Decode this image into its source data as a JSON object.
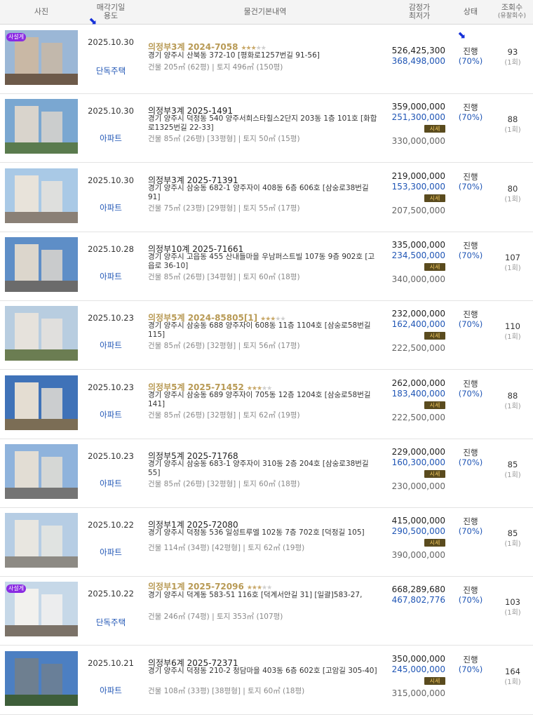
{
  "header": {
    "photo": "사진",
    "date_line1": "매각기일",
    "date_line2": "용도",
    "info": "물건기본내역",
    "price_line1": "감정가",
    "price_line2": "최저가",
    "status": "상태",
    "views_line1": "조회수",
    "views_line2": "(유찰회수)"
  },
  "rows": [
    {
      "badge": "사설게",
      "date": "2025.10.30",
      "use": "단독주택",
      "case": "의정부3계 2024-7058",
      "gold": true,
      "stars": 3,
      "addr": "경기 양주시 산북동 372-10 [평화로1257번길 91-56]",
      "area": "건물 205㎡ (62평)  |  토지 496㎡ (150평)",
      "appraisal": "526,425,300",
      "minimum": "368,498,000",
      "market": "",
      "status": "진행",
      "pct": "(70%)",
      "views": "93",
      "fails": "(1회)"
    },
    {
      "badge": "",
      "date": "2025.10.30",
      "use": "아파트",
      "case": "의정부3계 2025-1491",
      "gold": false,
      "stars": 0,
      "addr": "경기 양주시 덕정동 540 양주서희스타힐스2단지 203동 1층 101호 [화합로1325번길 22-33]",
      "area": "건물 85㎡ (26평) [33평형]  |  토지 50㎡ (15평)",
      "appraisal": "359,000,000",
      "minimum": "251,300,000",
      "market": "330,000,000",
      "status": "진행",
      "pct": "(70%)",
      "views": "88",
      "fails": "(1회)"
    },
    {
      "badge": "",
      "date": "2025.10.30",
      "use": "아파트",
      "case": "의정부3계 2025-71391",
      "gold": false,
      "stars": 0,
      "addr": "경기 양주시 삼숭동 682-1 양주자이 408동 6층 606호 [삼숭로38번길 91]",
      "area": "건물 75㎡ (23평) [29평형]  |  토지 55㎡ (17평)",
      "appraisal": "219,000,000",
      "minimum": "153,300,000",
      "market": "207,500,000",
      "status": "진행",
      "pct": "(70%)",
      "views": "80",
      "fails": "(1회)"
    },
    {
      "badge": "",
      "date": "2025.10.28",
      "use": "아파트",
      "case": "의정부10계 2025-71661",
      "gold": false,
      "stars": 0,
      "addr": "경기 양주시 고읍동 455 산내들마을 우남퍼스트빌 107동 9층 902호 [고읍로 36-10]",
      "area": "건물 85㎡ (26평) [34평형]  |  토지 60㎡ (18평)",
      "appraisal": "335,000,000",
      "minimum": "234,500,000",
      "market": "340,000,000",
      "status": "진행",
      "pct": "(70%)",
      "views": "107",
      "fails": "(1회)"
    },
    {
      "badge": "",
      "date": "2025.10.23",
      "use": "아파트",
      "case": "의정부5계 2024-85805[1]",
      "gold": true,
      "stars": 3,
      "addr": "경기 양주시 삼숭동 688 양주자이 608동 11층 1104호 [삼숭로58번길 115]",
      "area": "건물 85㎡ (26평) [32평형]  |  토지 56㎡ (17평)",
      "appraisal": "232,000,000",
      "minimum": "162,400,000",
      "market": "222,500,000",
      "status": "진행",
      "pct": "(70%)",
      "views": "110",
      "fails": "(1회)"
    },
    {
      "badge": "",
      "date": "2025.10.23",
      "use": "아파트",
      "case": "의정부5계 2025-71452",
      "gold": true,
      "stars": 3,
      "addr": "경기 양주시 삼숭동 689 양주자이 705동 12층 1204호 [삼숭로58번길 141]",
      "area": "건물 85㎡ (26평) [32평형]  |  토지 62㎡ (19평)",
      "appraisal": "262,000,000",
      "minimum": "183,400,000",
      "market": "222,500,000",
      "status": "진행",
      "pct": "(70%)",
      "views": "88",
      "fails": "(1회)"
    },
    {
      "badge": "",
      "date": "2025.10.23",
      "use": "아파트",
      "case": "의정부5계 2025-71768",
      "gold": false,
      "stars": 0,
      "addr": "경기 양주시 삼숭동 683-1 양주자이 310동 2층 204호 [삼숭로38번길 55]",
      "area": "건물 85㎡ (26평) [32평형]  |  토지 60㎡ (18평)",
      "appraisal": "229,000,000",
      "minimum": "160,300,000",
      "market": "230,000,000",
      "status": "진행",
      "pct": "(70%)",
      "views": "85",
      "fails": "(1회)"
    },
    {
      "badge": "",
      "date": "2025.10.22",
      "use": "아파트",
      "case": "의정부1계 2025-72080",
      "gold": false,
      "stars": 0,
      "addr": "경기 양주시 덕정동 536 일성트루엘 102동 7층 702호 [덕정길 105]",
      "area": "건물 114㎡ (34평) [42평형]  |  토지 62㎡ (19평)",
      "appraisal": "415,000,000",
      "minimum": "290,500,000",
      "market": "390,000,000",
      "status": "진행",
      "pct": "(70%)",
      "views": "85",
      "fails": "(1회)"
    },
    {
      "badge": "사설게",
      "date": "2025.10.22",
      "use": "단독주택",
      "case": "의정부1계 2025-72096",
      "gold": true,
      "stars": 3,
      "addr": "경기 양주시 덕계동 583-51 116호 [덕계서안길 31]  [일괄]583-27,",
      "area": "건물 246㎡ (74평)  |  토지 353㎡ (107평)",
      "appraisal": "668,289,680",
      "minimum": "467,802,776",
      "market": "",
      "status": "진행",
      "pct": "(70%)",
      "views": "103",
      "fails": "(1회)"
    },
    {
      "badge": "",
      "date": "2025.10.21",
      "use": "아파트",
      "case": "의정부6계 2025-72371",
      "gold": false,
      "stars": 0,
      "addr": "경기 양주시 덕정동 210-2 청담마을 403동 6층 602호 [고암길 305-40]",
      "area": "건물 108㎡ (33평) [38평형]  |  토지 60㎡ (18평)",
      "appraisal": "350,000,000",
      "minimum": "245,000,000",
      "market": "315,000,000",
      "status": "진행",
      "pct": "(70%)",
      "views": "164",
      "fails": "(1회)"
    }
  ],
  "sise_label": "시세",
  "icons": {
    "arrow": "dotted-arrow-icon",
    "star": "star-icon",
    "market": "market-price-icon"
  }
}
